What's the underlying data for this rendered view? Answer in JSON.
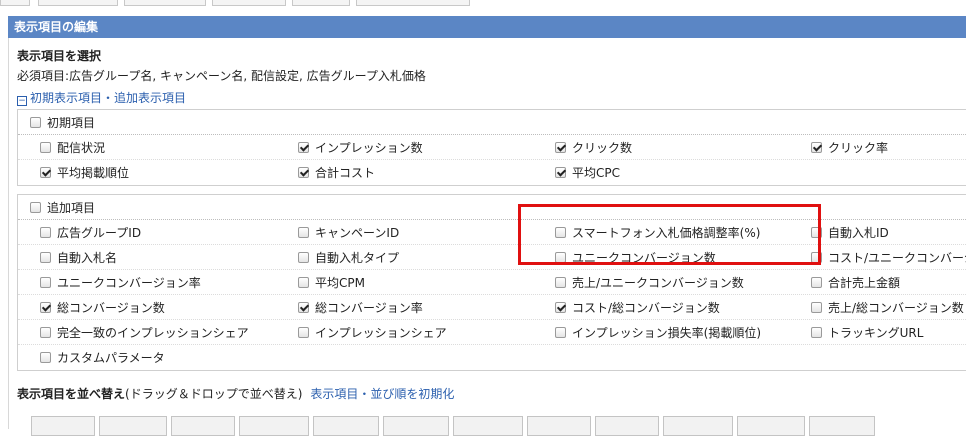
{
  "header": {
    "title": "表示項目の編集"
  },
  "select": {
    "title": "表示項目を選択",
    "required": "必須項目:広告グループ名, キャンペーン名, 配信設定, 広告グループ入札価格",
    "toggle_label": "初期表示項目・追加表示項目"
  },
  "initial": {
    "label": "初期項目",
    "checked": false,
    "rows": [
      [
        {
          "label": "配信状況",
          "checked": false
        },
        {
          "label": "インプレッション数",
          "checked": true
        },
        {
          "label": "クリック数",
          "checked": true
        },
        {
          "label": "クリック率",
          "checked": true
        }
      ],
      [
        {
          "label": "平均掲載順位",
          "checked": true
        },
        {
          "label": "合計コスト",
          "checked": true
        },
        {
          "label": "平均CPC",
          "checked": true
        }
      ]
    ]
  },
  "additional": {
    "label": "追加項目",
    "checked": false,
    "rows": [
      [
        {
          "label": "広告グループID",
          "checked": false
        },
        {
          "label": "キャンペーンID",
          "checked": false
        },
        {
          "label": "スマートフォン入札価格調整率(%)",
          "checked": false
        },
        {
          "label": "自動入札ID",
          "checked": false
        }
      ],
      [
        {
          "label": "自動入札名",
          "checked": false
        },
        {
          "label": "自動入札タイプ",
          "checked": false
        },
        {
          "label": "ユニークコンバージョン数",
          "checked": false
        },
        {
          "label": "コスト/ユニークコンバージ",
          "checked": false
        }
      ],
      [
        {
          "label": "ユニークコンバージョン率",
          "checked": false
        },
        {
          "label": "平均CPM",
          "checked": false
        },
        {
          "label": "売上/ユニークコンバージョン数",
          "checked": false
        },
        {
          "label": "合計売上金額",
          "checked": false
        }
      ],
      [
        {
          "label": "総コンバージョン数",
          "checked": true
        },
        {
          "label": "総コンバージョン率",
          "checked": true
        },
        {
          "label": "コスト/総コンバージョン数",
          "checked": true
        },
        {
          "label": "売上/総コンバージョン数",
          "checked": false
        }
      ],
      [
        {
          "label": "完全一致のインプレッションシェア",
          "checked": false
        },
        {
          "label": "インプレッションシェア",
          "checked": false
        },
        {
          "label": "インプレッション損失率(掲載順位)",
          "checked": false
        },
        {
          "label": "トラッキングURL",
          "checked": false
        }
      ],
      [
        {
          "label": "カスタムパラメータ",
          "checked": false
        }
      ]
    ]
  },
  "sort": {
    "title": "表示項目を並べ替え",
    "hint": "(ドラッグ＆ドロップで並べ替え)",
    "reset_label": "表示項目・並び順を初期化"
  },
  "colors": {
    "header_bg": "#5b86c5",
    "link": "#2b5fae",
    "highlight": "#e01010"
  }
}
